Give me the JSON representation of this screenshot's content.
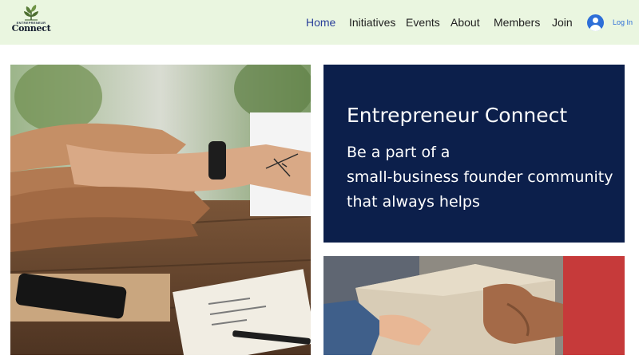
{
  "brand": {
    "logo_small": "ENTREPRENEUR",
    "logo_name": "Connect"
  },
  "nav": {
    "items": [
      {
        "label": "Home",
        "active": true
      },
      {
        "label": "Initiatives",
        "active": false
      },
      {
        "label": "Events",
        "active": false
      },
      {
        "label": "About",
        "active": false
      },
      {
        "label": "Members",
        "active": false
      },
      {
        "label": "Join",
        "active": false
      }
    ],
    "login_label": "Log In"
  },
  "hero": {
    "title": "Entrepreneur Connect",
    "lines": [
      "Be a part of a",
      "small-business founder community",
      "that always helps"
    ]
  },
  "colors": {
    "nav_background": "#eaf6e0",
    "hero_background": "#0c1f4b",
    "accent": "#2e6fd8"
  }
}
